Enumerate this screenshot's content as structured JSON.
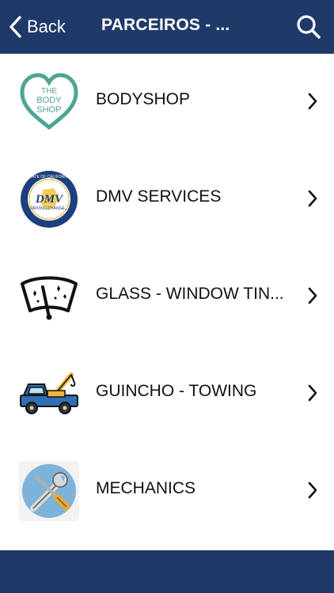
{
  "navbar": {
    "back_label": "Back",
    "title": "PARCEIROS - ..."
  },
  "items": [
    {
      "label": "BODYSHOP",
      "icon": "bodyshop-logo"
    },
    {
      "label": "DMV SERVICES",
      "icon": "dmv-logo"
    },
    {
      "label": "GLASS - WINDOW TIN...",
      "icon": "windshield-icon"
    },
    {
      "label": "GUINCHO - TOWING",
      "icon": "tow-truck-icon"
    },
    {
      "label": "MECHANICS",
      "icon": "wrench-screwdriver-icon"
    }
  ],
  "logo_text": {
    "bodyshop": [
      "THE",
      "BODY",
      "SHOP"
    ],
    "dmv_top": "STATE OF CALIFORNIA",
    "dmv_mid": "DMV",
    "dmv_sub": "DRIVING CHANGE..."
  },
  "colors": {
    "navbar": "#1f3a68",
    "bodyshop_green": "#4fa593"
  }
}
